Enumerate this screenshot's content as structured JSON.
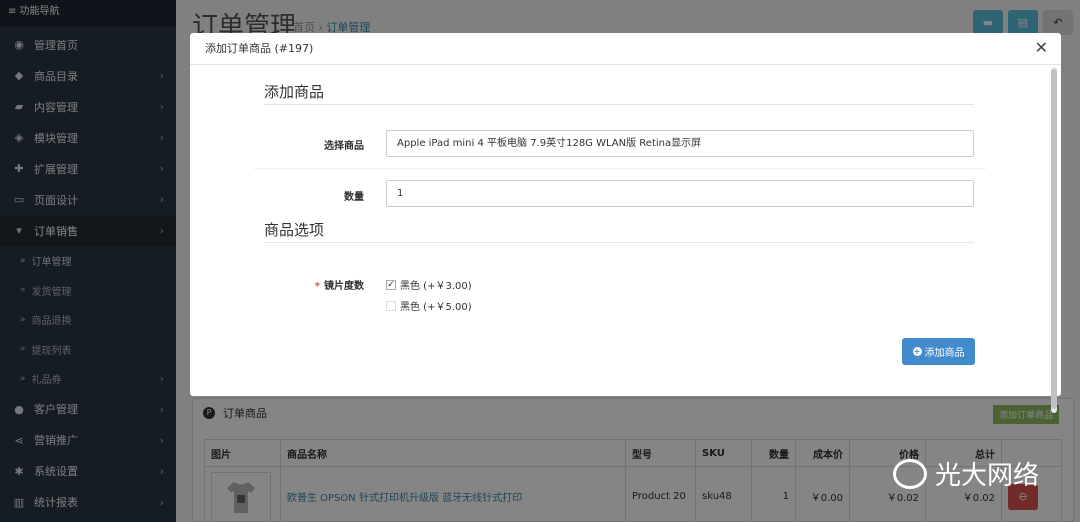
{
  "sidebar": {
    "header": "≡ 功能导航",
    "items": [
      {
        "label": "管理首页",
        "icon": "dashboard-icon"
      },
      {
        "label": "商品目录",
        "icon": "tags-icon"
      },
      {
        "label": "内容管理",
        "icon": "book-icon"
      },
      {
        "label": "模块管理",
        "icon": "cube-icon"
      },
      {
        "label": "扩展管理",
        "icon": "puzzle-icon"
      },
      {
        "label": "页面设计",
        "icon": "desktop-icon"
      },
      {
        "label": "订单销售",
        "icon": "cart-icon"
      }
    ],
    "sub_items": [
      "订单管理",
      "发货管理",
      "商品退换",
      "提现列表",
      "礼品券"
    ],
    "bottom_items": [
      {
        "label": "客户管理",
        "icon": "user-icon"
      },
      {
        "label": "营销推广",
        "icon": "share-icon"
      },
      {
        "label": "系统设置",
        "icon": "gear-icon"
      },
      {
        "label": "统计报表",
        "icon": "bar-chart-icon"
      }
    ]
  },
  "header": {
    "title": "订单管理",
    "breadcrumb_home": "首页",
    "breadcrumb_current": "订单管理"
  },
  "modal": {
    "title": "添加订单商品 (#197)",
    "section_product": "添加商品",
    "label_product": "选择商品",
    "product_value": "Apple iPad mini 4 平板电脑 7.9英寸128G WLAN版 Retina显示屏",
    "label_qty": "数量",
    "qty_value": "1",
    "section_options": "商品选项",
    "label_option": "镜片度数",
    "option_1": "黑色 (+￥3.00)",
    "option_2": "黑色 (+￥5.00)",
    "add_button": "添加商品"
  },
  "order_panel": {
    "title": "订单商品",
    "add_button": "添加订单商品",
    "columns": [
      "图片",
      "商品名称",
      "型号",
      "SKU",
      "数量",
      "成本价",
      "价格",
      "总计"
    ],
    "rows": [
      {
        "name": "欧普生 OPSON 针式打印机升级版 蓝牙无线针式打印",
        "model": "Product 20",
        "sku": "sku48",
        "qty": "1",
        "cost": "￥0.00",
        "price": "￥0.02",
        "total": "￥0.02"
      }
    ]
  },
  "watermark": "光大网络"
}
